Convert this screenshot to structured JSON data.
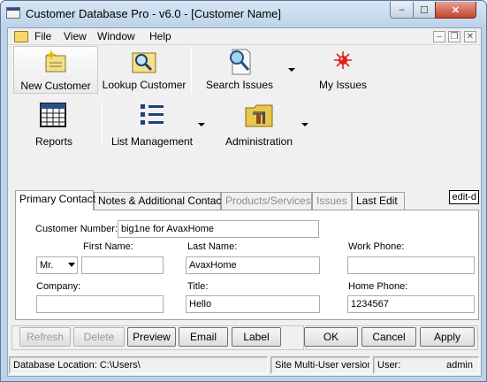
{
  "window": {
    "title": "Customer Database Pro - v6.0 - [Customer Name]",
    "minimize_glyph": "‒",
    "maximize_glyph": "☐",
    "close_glyph": "✕"
  },
  "menubar": {
    "items": [
      "File",
      "View",
      "Window",
      "Help"
    ],
    "mdi_minimize": "–",
    "mdi_restore": "❐",
    "mdi_close": "✕"
  },
  "toolbar1": {
    "new_customer": "New Customer",
    "lookup_customer": "Lookup Customer",
    "search_issues": "Search Issues",
    "my_issues": "My Issues"
  },
  "toolbar2": {
    "reports": "Reports",
    "list_management": "List Management",
    "administration": "Administration"
  },
  "tabs": {
    "primary_contact": "Primary Contact",
    "notes": "Notes & Additional Contacts",
    "products": "Products/Services",
    "issues": "Issues",
    "last_edit": "Last Edit",
    "edit_control": "edit-d"
  },
  "form": {
    "customer_number_label": "Customer Number:",
    "customer_number": "big1ne for AvaxHome",
    "first_name_label": "First Name:",
    "last_name_label": "Last Name:",
    "work_phone_label": "Work Phone:",
    "salutation": "Mr.",
    "first_name": "",
    "last_name": "AvaxHome",
    "work_phone": "",
    "company_label": "Company:",
    "title_label": "Title:",
    "home_phone_label": "Home Phone:",
    "company": "",
    "title": "Hello",
    "home_phone": "1234567"
  },
  "buttons": {
    "refresh": "Refresh",
    "delete": "Delete",
    "preview": "Preview",
    "email": "Email",
    "label": "Label",
    "ok": "OK",
    "cancel": "Cancel",
    "apply": "Apply"
  },
  "status": {
    "database_location": "Database Location: C:\\Users\\",
    "mode": "Site Multi-User version",
    "user_label": "User:",
    "user": "admin"
  },
  "colors": {
    "accent": "#2c4f8a",
    "my_issues_icon": "#e0201b",
    "folder_icon": "#e8c64a"
  }
}
